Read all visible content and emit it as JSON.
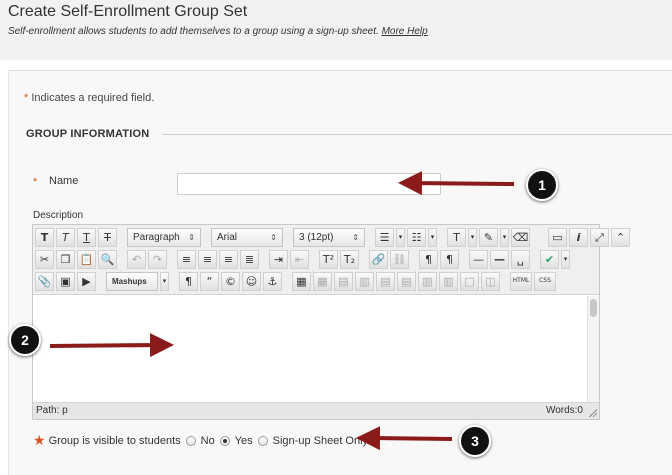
{
  "page": {
    "title": "Create Self-Enrollment Group Set",
    "description": "Self-enrollment allows students to add themselves to a group using a sign-up sheet.",
    "help_link": "More Help"
  },
  "form": {
    "required_star": "*",
    "required_note": "Indicates a required field.",
    "section_title": "GROUP INFORMATION",
    "name_label": "Name",
    "name_value": "",
    "description_label": "Description"
  },
  "editor": {
    "paragraph_select": "Paragraph",
    "font_select": "Arial",
    "size_select": "3 (12pt)",
    "mashups": "Mashups",
    "html_button": "HTML",
    "css_button": "CSS",
    "path": "Path: p",
    "words": "Words:0"
  },
  "visibility": {
    "label": "Group is visible to students",
    "options": [
      "No",
      "Yes",
      "Sign-up Sheet Only"
    ],
    "selected": "Yes"
  },
  "callouts": [
    "1",
    "2",
    "3"
  ],
  "colors": {
    "required_star": "#d9541e",
    "arrow": "#8b1a1a"
  }
}
